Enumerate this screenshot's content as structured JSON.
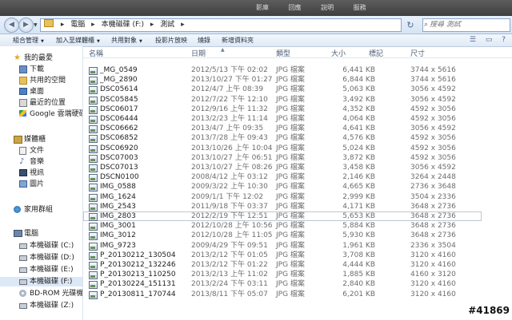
{
  "browser_tabs": [
    "影庫",
    "回應",
    "說明",
    "服務"
  ],
  "address": {
    "segments": [
      "電腦",
      "本機磁碟 (F:)",
      "測試"
    ]
  },
  "search": {
    "placeholder": "搜尋 測試"
  },
  "toolbar": {
    "organize": "組合管理",
    "include_library": "加入至媒體櫃",
    "share": "共用對象",
    "slideshow": "投影片放映",
    "burn": "燒錄",
    "new_folder": "新增資料夾"
  },
  "nav": {
    "favorites": "我的最愛",
    "downloads": "下載",
    "shared_space": "共用的空間",
    "desktop": "桌面",
    "recent": "最近的位置",
    "google_drive": "Google 雲端硬碟",
    "libraries": "媒體櫃",
    "documents": "文件",
    "music": "音樂",
    "videos": "視訊",
    "pictures": "圖片",
    "homegroup": "家用群組",
    "computer": "電腦",
    "drive_c": "本機磁碟 (C:)",
    "drive_d": "本機磁碟 (D:)",
    "drive_e": "本機磁碟 (E:)",
    "drive_f": "本機磁碟 (F:)",
    "drive_g": "BD-ROM 光碟機",
    "drive_z": "本機磁碟 (Z:)"
  },
  "columns": {
    "name": "名稱",
    "date": "日期",
    "type": "類型",
    "size": "大小",
    "tags": "標記",
    "dimensions": "尺寸"
  },
  "files": [
    {
      "name": "_MG_0549",
      "date": "2012/5/13 下午 02:02",
      "type": "JPG 檔案",
      "size": "6,441 KB",
      "dim": "3744 x 5616"
    },
    {
      "name": "_MG_2890",
      "date": "2013/10/27 下午 01:27",
      "type": "JPG 檔案",
      "size": "6,844 KB",
      "dim": "3744 x 5616"
    },
    {
      "name": "DSC05614",
      "date": "2012/4/7 上午 08:39",
      "type": "JPG 檔案",
      "size": "5,063 KB",
      "dim": "3056 x 4592"
    },
    {
      "name": "DSC05845",
      "date": "2012/7/22 下午 12:10",
      "type": "JPG 檔案",
      "size": "3,492 KB",
      "dim": "3056 x 4592"
    },
    {
      "name": "DSC06017",
      "date": "2012/9/16 上午 11:32",
      "type": "JPG 檔案",
      "size": "4,352 KB",
      "dim": "4592 x 3056"
    },
    {
      "name": "DSC06444",
      "date": "2013/2/23 上午 11:14",
      "type": "JPG 檔案",
      "size": "4,064 KB",
      "dim": "4592 x 3056"
    },
    {
      "name": "DSC06662",
      "date": "2013/4/7 上午 09:35",
      "type": "JPG 檔案",
      "size": "4,641 KB",
      "dim": "3056 x 4592"
    },
    {
      "name": "DSC06852",
      "date": "2013/7/28 上午 09:43",
      "type": "JPG 檔案",
      "size": "4,576 KB",
      "dim": "4592 x 3056"
    },
    {
      "name": "DSC06920",
      "date": "2013/10/26 上午 10:04",
      "type": "JPG 檔案",
      "size": "5,024 KB",
      "dim": "4592 x 3056"
    },
    {
      "name": "DSC07003",
      "date": "2013/10/27 上午 06:51",
      "type": "JPG 檔案",
      "size": "3,872 KB",
      "dim": "4592 x 3056"
    },
    {
      "name": "DSC07013",
      "date": "2013/10/27 上午 08:26",
      "type": "JPG 檔案",
      "size": "3,458 KB",
      "dim": "3056 x 4592"
    },
    {
      "name": "DSCN0100",
      "date": "2008/4/12 上午 03:12",
      "type": "JPG 檔案",
      "size": "2,146 KB",
      "dim": "3264 x 2448"
    },
    {
      "name": "IMG_0588",
      "date": "2009/3/22 上午 10:30",
      "type": "JPG 檔案",
      "size": "4,665 KB",
      "dim": "2736 x 3648"
    },
    {
      "name": "IMG_1624",
      "date": "2009/1/1 下午 12:02",
      "type": "JPG 檔案",
      "size": "2,999 KB",
      "dim": "3504 x 2336"
    },
    {
      "name": "IMG_2543",
      "date": "2011/9/18 下午 03:37",
      "type": "JPG 檔案",
      "size": "4,171 KB",
      "dim": "3648 x 2736"
    },
    {
      "name": "IMG_2803",
      "date": "2012/2/19 下午 12:51",
      "type": "JPG 檔案",
      "size": "5,653 KB",
      "dim": "3648 x 2736"
    },
    {
      "name": "IMG_3001",
      "date": "2012/10/28 上午 10:56",
      "type": "JPG 檔案",
      "size": "5,884 KB",
      "dim": "3648 x 2736"
    },
    {
      "name": "IMG_3012",
      "date": "2012/10/28 上午 11:05",
      "type": "JPG 檔案",
      "size": "5,930 KB",
      "dim": "3648 x 2736"
    },
    {
      "name": "IMG_9723",
      "date": "2009/4/29 下午 09:51",
      "type": "JPG 檔案",
      "size": "1,961 KB",
      "dim": "2336 x 3504"
    },
    {
      "name": "P_20130212_130504",
      "date": "2013/2/12 下午 01:05",
      "type": "JPG 檔案",
      "size": "3,708 KB",
      "dim": "3120 x 4160"
    },
    {
      "name": "P_20130212_132246",
      "date": "2013/2/12 下午 01:22",
      "type": "JPG 檔案",
      "size": "4,444 KB",
      "dim": "3120 x 4160"
    },
    {
      "name": "P_20130213_110250",
      "date": "2013/2/13 上午 11:02",
      "type": "JPG 檔案",
      "size": "1,885 KB",
      "dim": "4160 x 3120"
    },
    {
      "name": "P_20130224_151131",
      "date": "2013/2/24 下午 03:11",
      "type": "JPG 檔案",
      "size": "2,840 KB",
      "dim": "3120 x 4160"
    },
    {
      "name": "P_20130811_170744",
      "date": "2013/8/11 下午 05:07",
      "type": "JPG 檔案",
      "size": "6,201 KB",
      "dim": "3120 x 4160"
    }
  ],
  "selected_index": 15,
  "watermark": "#41869",
  "colors": {
    "selection": "#dce8f6",
    "folder": "#e8c15a",
    "header_text": "#4c607a"
  }
}
